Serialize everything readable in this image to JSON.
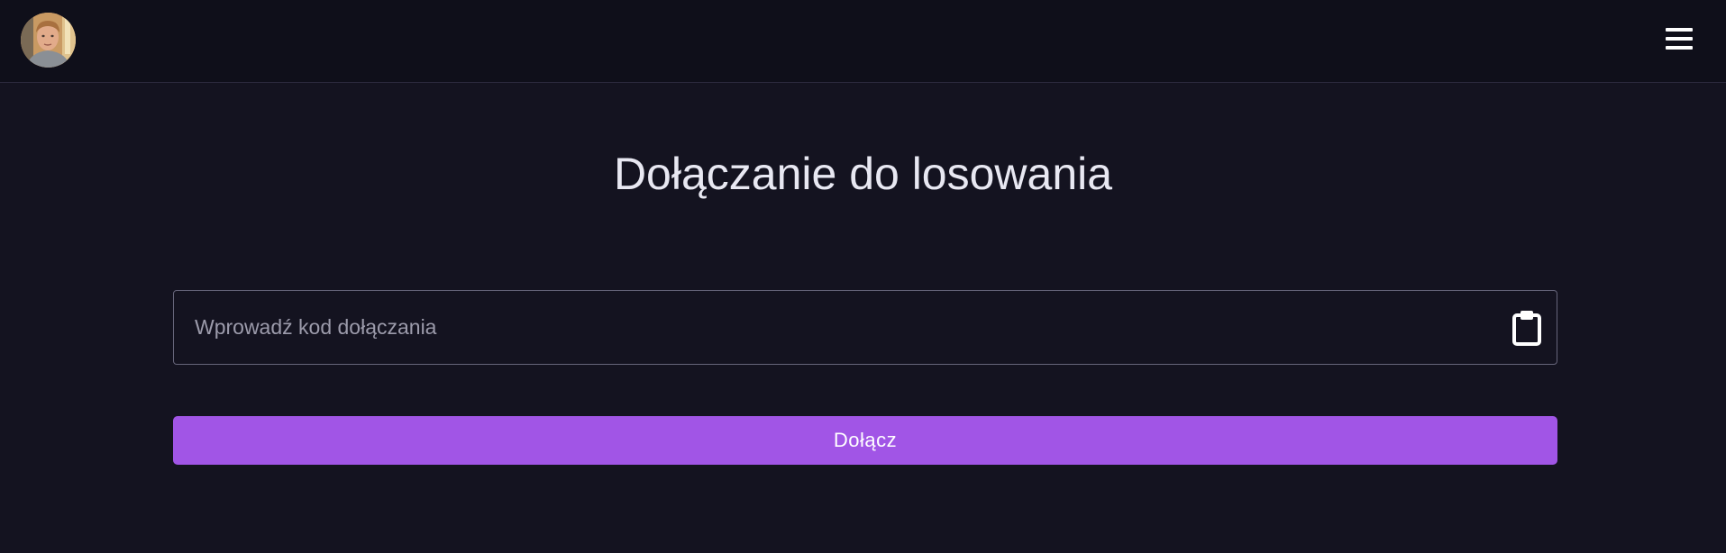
{
  "header": {
    "avatar_icon": "user-avatar-photo",
    "menu_icon": "hamburger-menu-icon"
  },
  "main": {
    "title": "Dołączanie do losowania",
    "code_input": {
      "value": "",
      "placeholder": "Wprowadź kod dołączania",
      "paste_icon": "clipboard-icon"
    },
    "join_button_label": "Dołącz"
  },
  "colors": {
    "background": "#141320",
    "header_background": "#0f0f1a",
    "accent": "#a155e6",
    "text": "#e8e8f2",
    "placeholder": "#9c9bab",
    "field_border": "#66657a"
  }
}
